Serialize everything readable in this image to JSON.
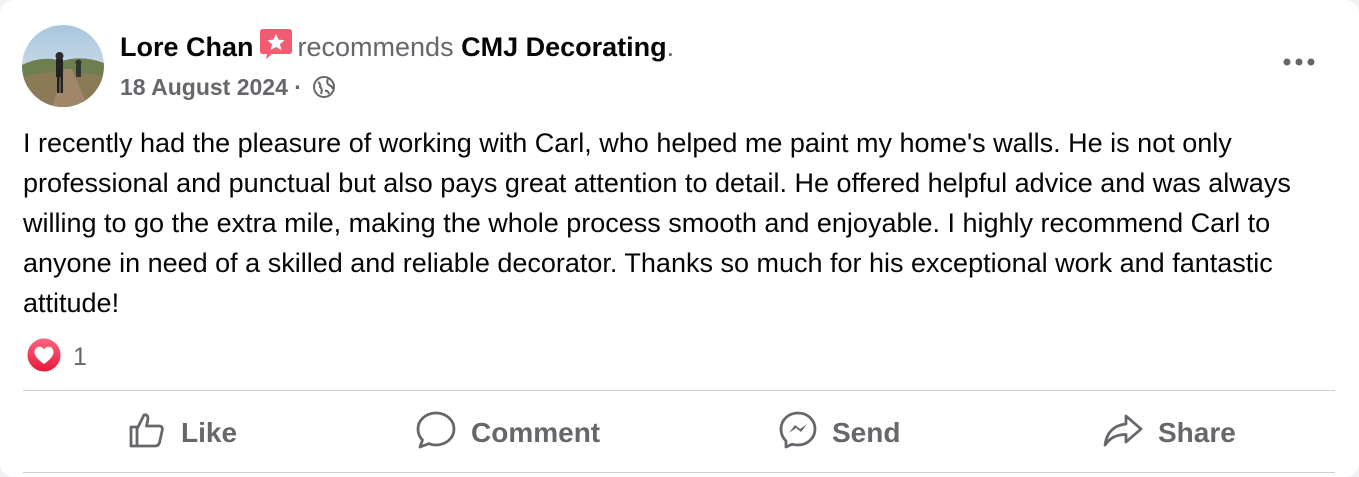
{
  "post": {
    "author": "Lore Chan",
    "recommends_text": "recommends",
    "page_name": "CMJ Decorating",
    "period": ".",
    "date": "18 August 2024",
    "separator": " · ",
    "privacy_icon": "globe-icon",
    "body": "I recently had the pleasure of working with Carl, who helped me paint my home's walls. He is not only professional and punctual but also pays great attention to detail. He offered helpful advice and was always willing to go the extra mile, making the whole process smooth and enjoyable. I highly recommend Carl to anyone in need of a skilled and reliable decorator. Thanks so much for his exceptional work and fantastic attitude!",
    "reactions": {
      "icon": "love-reaction-icon",
      "count": "1"
    }
  },
  "actions": [
    {
      "label": "Like",
      "icon": "thumbs-up-icon"
    },
    {
      "label": "Comment",
      "icon": "comment-icon"
    },
    {
      "label": "Send",
      "icon": "messenger-icon"
    },
    {
      "label": "Share",
      "icon": "share-icon"
    }
  ],
  "colors": {
    "text": "#050505",
    "secondary": "#65676b",
    "divider": "#ced0d4",
    "badge": "#f25c73",
    "love": "#f33e58"
  }
}
